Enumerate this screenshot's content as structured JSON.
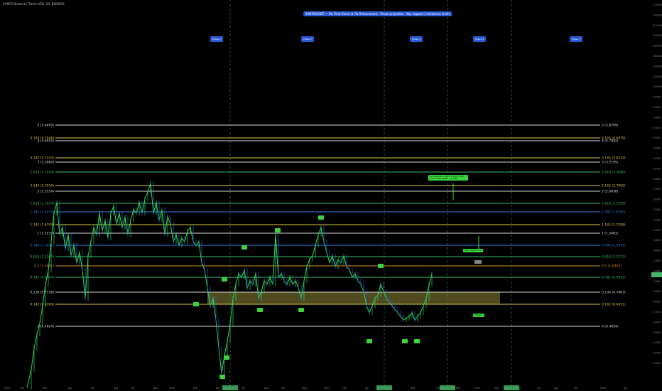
{
  "header": {
    "symbol": "SANTO Network / Tether USD, 1D, BINANCE"
  },
  "banner": {
    "text": "SANTO/USDT — Fib Time Zones & Fib Retracement · Phase projection · Key support / resistance levels"
  },
  "phase_labels": [
    "Phase 1",
    "Phase 2",
    "Phase 3",
    "Phase 4",
    "Phase 5"
  ],
  "box_label": "Phase 3",
  "annotations": {
    "ath_note": "Fib extension path, 2.618 target zone of 60 weeks / 3.3955",
    "resistance_note": "Key target zone",
    "gray_label": "Target"
  },
  "colors": {
    "background": "#000000",
    "fib_white": "#d9d9d9",
    "fib_yellow": "#d8c94a",
    "fib_green": "#3fb96a",
    "fib_blue": "#3b7de0",
    "fib_orange": "#d98b2b",
    "zone_fill": "#6b6428",
    "candle_green": "#2fd15a",
    "candle_blue": "#2f5fd1",
    "callout_blue": "#2a5bd7",
    "marker_green": "#3bd43b",
    "vline_green": "#2e9b52"
  },
  "chart_data": {
    "type": "candlestick",
    "fib_levels_left": [
      {
        "label": "5 (5.6499)",
        "color": "white"
      },
      {
        "label": "4.145 (4.7648)",
        "color": "yellow"
      },
      {
        "label": "4 (4.6055)",
        "color": "white"
      },
      {
        "label": "3.142 (3.7334)",
        "color": "yellow"
      },
      {
        "label": "3 (3.5869)",
        "color": "white"
      },
      {
        "label": "2.618 (3.1929)",
        "color": "green"
      },
      {
        "label": "2.142 (2.7019)",
        "color": "yellow"
      },
      {
        "label": "2 (2.5554)",
        "color": "white"
      },
      {
        "label": "1.618 (2.1614)",
        "color": "green"
      },
      {
        "label": "1.382 (1.9179)",
        "color": "blue"
      },
      {
        "label": "1.142 (1.6704)",
        "color": "yellow"
      },
      {
        "label": "1 (1.5239)",
        "color": "white"
      },
      {
        "label": "0.786 (1.3032)",
        "color": "blue"
      },
      {
        "label": "0.618 (1.1299)",
        "color": "green"
      },
      {
        "label": "0.5 (1.0082)",
        "color": "orange"
      },
      {
        "label": "0.382 (0.8864)",
        "color": "green"
      },
      {
        "label": "0.236 (0.7358)",
        "color": "white"
      },
      {
        "label": "0.142 (0.6389)",
        "color": "yellow"
      },
      {
        "label": "0 (0.4924)",
        "color": "white"
      }
    ],
    "fib_levels_right": [
      {
        "label": "5 (5.8709)"
      },
      {
        "label": "4.145 (4.6479)"
      },
      {
        "label": "4 (4.7992)"
      },
      {
        "label": "3.145 (3.8722)"
      },
      {
        "label": "3 (3.7195)"
      },
      {
        "label": "2.618 (3.3086)"
      },
      {
        "label": "2.142 (2.7965)"
      },
      {
        "label": "2 (2.6438)"
      },
      {
        "label": "1.618 (2.2329)"
      },
      {
        "label": "1.382 (1.9790)"
      },
      {
        "label": "1.142 (1.7208)"
      },
      {
        "label": "1 (1.5681)"
      },
      {
        "label": "0.786 (1.3379)"
      },
      {
        "label": "0.618 (1.1572)"
      },
      {
        "label": "0.5 (1.0303)"
      },
      {
        "label": "0.382 (0.9032)"
      },
      {
        "label": "0.236 (0.7463)"
      },
      {
        "label": "0.142 (0.6451)"
      },
      {
        "label": "0 (0.4924)"
      }
    ],
    "x_ticks": [
      "2021",
      "Feb",
      "Mar",
      "Apr",
      "Jun",
      "Aug",
      "Oct",
      "Nov",
      "2022",
      "Feb",
      "Apr",
      "Jun",
      "Aug",
      "Oct",
      "Nov",
      "2023",
      "Feb",
      "Apr",
      "Jun",
      "Aug",
      "Oct",
      "Dec",
      "2024",
      "Mar",
      "Apr",
      "Jun",
      "Aug",
      "Oct",
      "2025",
      "Apr"
    ],
    "y_ticks": [
      "27.0000",
      "24.0000",
      "22.0000",
      "20.0000",
      "18.0000",
      "16.0000",
      "14.0000",
      "12.0000",
      "10.0000",
      "9.0000",
      "8.0000",
      "7.0000",
      "6.5000",
      "6.0000",
      "5.5000",
      "5.0000",
      "4.5000",
      "4.0000",
      "3.5000",
      "3.0000",
      "2.5000",
      "2.2000",
      "2.0000",
      "1.8000",
      "1.6000",
      "1.4000",
      "1.2000",
      "1.0000",
      "0.9000",
      "0.8000",
      "0.7000",
      "0.6000",
      "0.5000",
      "0.4000",
      "0.3500",
      "0.3000"
    ],
    "current_price": "0.9283",
    "vline_labels": [
      "Sep 14 2022",
      "Mar 27 2023",
      "Nov 01 2023",
      "Apr 04 2024"
    ]
  }
}
